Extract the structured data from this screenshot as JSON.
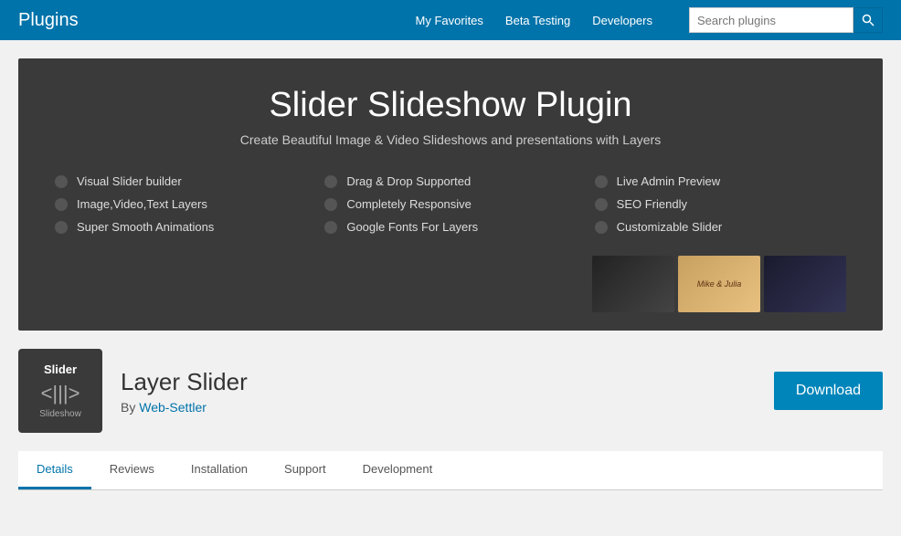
{
  "header": {
    "logo": "Plugins",
    "nav": [
      {
        "label": "My Favorites",
        "id": "my-favorites"
      },
      {
        "label": "Beta Testing",
        "id": "beta-testing"
      },
      {
        "label": "Developers",
        "id": "developers"
      }
    ],
    "search_placeholder": "Search plugins"
  },
  "banner": {
    "title": "Slider Slideshow Plugin",
    "subtitle": "Create Beautiful Image & Video Slideshows and presentations with Layers",
    "features": [
      {
        "label": "Visual Slider builder"
      },
      {
        "label": "Drag & Drop Supported"
      },
      {
        "label": "Live Admin Preview"
      },
      {
        "label": "Image,Video,Text Layers"
      },
      {
        "label": "Completely Responsive"
      },
      {
        "label": "SEO Friendly"
      },
      {
        "label": "Super Smooth Animations"
      },
      {
        "label": "Google Fonts For Layers"
      },
      {
        "label": "Customizable Slider"
      }
    ]
  },
  "plugin": {
    "name": "Layer Slider",
    "author_label": "By",
    "author_name": "Web-Settler",
    "icon_title": "Slider",
    "icon_symbol": "<|||>",
    "icon_sub": "Slideshow",
    "download_label": "Download"
  },
  "tabs": [
    {
      "label": "Details",
      "active": true
    },
    {
      "label": "Reviews"
    },
    {
      "label": "Installation"
    },
    {
      "label": "Support"
    },
    {
      "label": "Development"
    }
  ]
}
